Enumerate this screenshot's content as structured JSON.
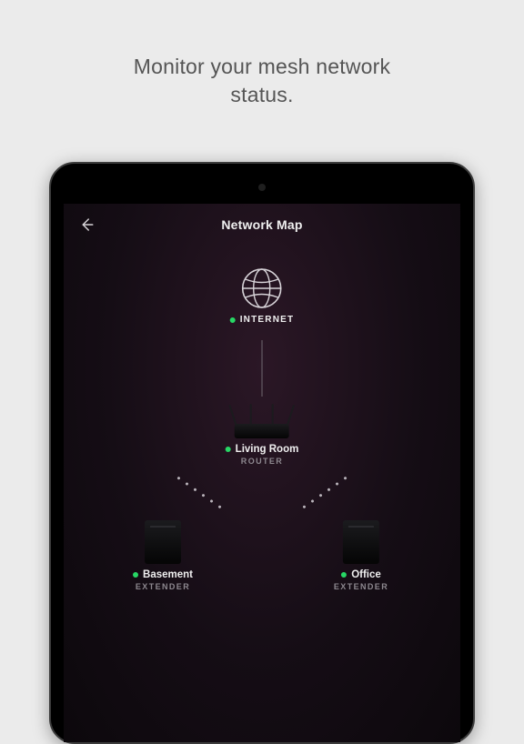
{
  "promo": {
    "line1": "Monitor your mesh network",
    "line2": "status."
  },
  "header": {
    "title": "Network Map"
  },
  "colors": {
    "status_online": "#27d765"
  },
  "nodes": {
    "internet": {
      "name": "INTERNET",
      "status": "online"
    },
    "router": {
      "name": "Living Room",
      "role": "ROUTER",
      "status": "online"
    },
    "extenders": [
      {
        "name": "Basement",
        "role": "EXTENDER",
        "status": "online"
      },
      {
        "name": "Office",
        "role": "EXTENDER",
        "status": "online"
      }
    ]
  }
}
